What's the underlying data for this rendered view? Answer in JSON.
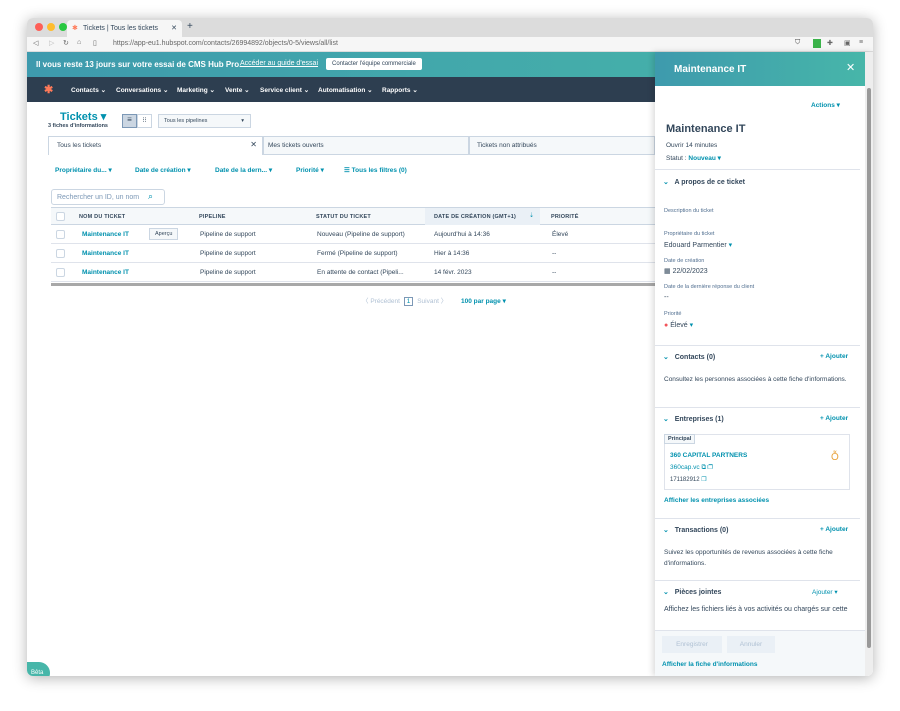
{
  "browser": {
    "tab_title": "Tickets | Tous les tickets",
    "url": "https://app-eu1.hubspot.com/contacts/26994892/objects/0-5/views/all/list"
  },
  "banner": {
    "text": "Il vous reste 13 jours sur votre essai de CMS Hub Pro.",
    "link": "Accéder au guide d'essai",
    "button": "Contacter l'équipe commerciale"
  },
  "nav": [
    "Contacts",
    "Conversations",
    "Marketing",
    "Vente",
    "Service client",
    "Automatisation",
    "Rapports"
  ],
  "header": {
    "title": "Tickets",
    "count": "3 fiches d'informations",
    "pipeline": "Tous les pipelines"
  },
  "views": [
    "Tous les tickets",
    "Mes tickets ouverts",
    "Tickets non attribués"
  ],
  "filters": [
    "Propriétaire du...",
    "Date de création",
    "Date de la dern...",
    "Priorité",
    "Tous les filtres (0)"
  ],
  "search_placeholder": "Rechercher un ID, un nom",
  "columns": [
    "NOM DU TICKET",
    "PIPELINE",
    "STATUT DU TICKET",
    "DATE DE CRÉATION (GMT+1)",
    "PRIORITÉ"
  ],
  "rows": [
    {
      "name": "Maintenance IT",
      "pipeline": "Pipeline de support",
      "status": "Nouveau (Pipeline de support)",
      "date": "Aujourd'hui à 14:36",
      "priority": "Élevé"
    },
    {
      "name": "Maintenance IT",
      "pipeline": "Pipeline de support",
      "status": "Fermé (Pipeline de support)",
      "date": "Hier à 14:36",
      "priority": "--"
    },
    {
      "name": "Maintenance IT",
      "pipeline": "Pipeline de support",
      "status": "En attente de contact (Pipeli...",
      "date": "14 févr. 2023",
      "priority": "--"
    }
  ],
  "preview_label": "Aperçu",
  "pagination": {
    "prev": "Précédent",
    "page": "1",
    "next": "Suivant",
    "per_page": "100 par page"
  },
  "beta": "Bêta",
  "panel": {
    "header": "Maintenance IT",
    "actions": "Actions",
    "title": "Maintenance IT",
    "open": "Ouvrir 14 minutes",
    "status_label": "Statut :",
    "status": "Nouveau",
    "about": "A propos de ce ticket",
    "desc_label": "Description du ticket",
    "owner_label": "Propriétaire du ticket",
    "owner": "Edouard Parmentier",
    "created_label": "Date de création",
    "created": "22/02/2023",
    "last_reply_label": "Date de la dernière réponse du client",
    "last_reply": "--",
    "priority_label": "Priorité",
    "priority": "Élevé",
    "contacts": "Contacts (0)",
    "contacts_text": "Consultez les personnes associées à cette fiche d'informations.",
    "add": "+ Ajouter",
    "companies": "Entreprises (1)",
    "principal": "Principal",
    "company_name": "360 CAPITAL PARTNERS",
    "company_domain": "360cap.vc",
    "company_phone": "171182912",
    "companies_link": "Afficher les entreprises associées",
    "deals": "Transactions (0)",
    "deals_text": "Suivez les opportunités de revenus associées à cette fiche d'informations.",
    "attachments": "Pièces jointes",
    "attachments_add": "Ajouter",
    "attachments_text": "Affichez les fichiers liés à vos activités ou chargés sur cette",
    "save": "Enregistrer",
    "cancel": "Annuler",
    "view_record": "Afficher la fiche d'informations"
  }
}
